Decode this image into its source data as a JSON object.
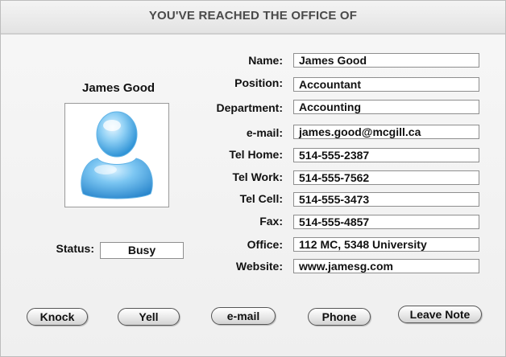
{
  "window": {
    "title": "YOU'VE REACHED THE OFFICE OF"
  },
  "profile": {
    "name": "James Good",
    "avatar_icon": "user-silhouette-icon",
    "status_label": "Status:",
    "status_value": "Busy"
  },
  "fields": [
    {
      "label": "Name:",
      "value": "James Good"
    },
    {
      "label": "Position:",
      "value": "Accountant"
    },
    {
      "label": "Department:",
      "value": "Accounting"
    },
    {
      "label": "e-mail:",
      "value": "james.good@mcgill.ca"
    },
    {
      "label": "Tel Home:",
      "value": "514-555-2387"
    },
    {
      "label": "Tel Work:",
      "value": "514-555-7562"
    },
    {
      "label": "Tel Cell:",
      "value": "514-555-3473"
    },
    {
      "label": "Fax:",
      "value": "514-555-4857"
    },
    {
      "label": "Office:",
      "value": "112 MC, 5348 University"
    },
    {
      "label": "Website:",
      "value": "www.jamesg.com"
    }
  ],
  "actions": {
    "knock": "Knock",
    "yell": "Yell",
    "email": "e-mail",
    "phone": "Phone",
    "leave_note": "Leave Note"
  },
  "colors": {
    "avatar_blue": "#3fa9e6",
    "avatar_highlight": "#bfe6fb",
    "border": "#8e8e8e"
  }
}
